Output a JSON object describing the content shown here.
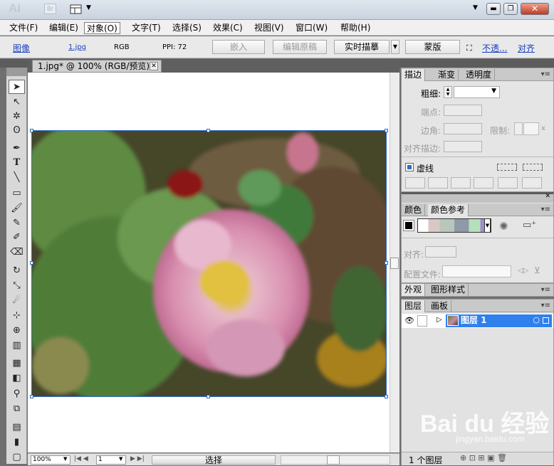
{
  "app": {
    "logo": "Ai",
    "bridge": "Br"
  },
  "menu": [
    "文件(F)",
    "编辑(E)",
    "对象(O)",
    "文字(T)",
    "选择(S)",
    "效果(C)",
    "视图(V)",
    "窗口(W)",
    "帮助(H)"
  ],
  "control": {
    "kind": "图像",
    "file": "1.jpg",
    "mode": "RGB",
    "ppi": "PPI: 72",
    "embed": "嵌入",
    "edit_original": "编辑原稿",
    "live_trace": "实时描摹",
    "mask": "蒙版",
    "opacity": "不透...",
    "align": "对齐"
  },
  "document": {
    "tab": "1.jpg* @ 100% (RGB/预览)"
  },
  "status": {
    "zoom": "100%",
    "page": "1",
    "text": "选择"
  },
  "stroke_panel": {
    "tabs": [
      "描边",
      "渐变",
      "透明度"
    ],
    "weight": "粗细:",
    "cap": "端点:",
    "corner": "边角:",
    "limit": "限制:",
    "limit_x": "x",
    "align": "对齐描边:",
    "dashed": "虚线"
  },
  "color_panel": {
    "tabs": [
      "颜色",
      "颜色参考"
    ],
    "align": "对齐:",
    "profile": "配置文件:"
  },
  "appearance_panel": {
    "tabs": [
      "外观",
      "图形样式"
    ]
  },
  "layers_panel": {
    "tabs": [
      "图层",
      "画板"
    ],
    "layer_name": "图层 1",
    "footer": "1 个图层"
  },
  "watermark": {
    "brand": "Bai du 经验",
    "url": "jingyan.baidu.com"
  },
  "colors": {
    "selection": "#2f80ed",
    "close": "#c23a20"
  }
}
